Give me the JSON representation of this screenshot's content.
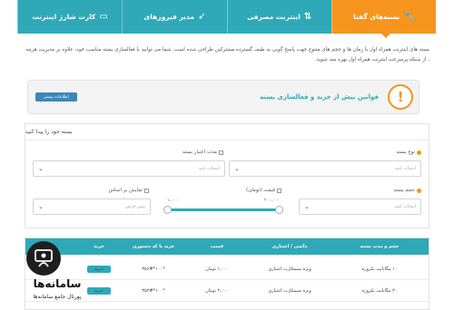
{
  "tabs": [
    {
      "label": "بسته‌های گفتا",
      "icon": "wrench-icon",
      "active": true
    },
    {
      "label": "اینترنت مصرفی",
      "icon": "updown-arrows-icon",
      "active": false
    },
    {
      "label": "مدیر فیروزهای",
      "icon": "rocket-icon",
      "active": false
    },
    {
      "label": "کارت شارژ اینترنت",
      "icon": "card-icon",
      "active": false
    }
  ],
  "intro_text": "بسته های اینترنت همراه اول با زمان ها و حجم های متنوع جهت پاسخ گویی به طیف گسترده مشترکین طراحی شده است. شما می توانید با فعالسازی بسته مناسب خود، علاوه بر مدیریت هزینه ، از شبکه پرسرعت اینترنت همراه اول بهره مند شوید.",
  "tip": {
    "title": "قوانین بیش از خرید و فعالسازی بسته",
    "button": "اطلاعات بیشتر",
    "icon": "exclamation-icon"
  },
  "finder": {
    "title": "بسته خود را پیدا کنید",
    "fields": {
      "package_type": {
        "label": "نوع بسته",
        "placeholder": "انتخاب کنید"
      },
      "validity": {
        "label": "مدت اعتبار بسته",
        "placeholder": "انتخاب کنید"
      },
      "volume": {
        "label": "حجم بسته",
        "placeholder": "انتخاب کنید"
      },
      "price": {
        "label": "قیمت (تومان)",
        "min": "۱,۰۰۰",
        "max": "۲۰۰,۰۰۰"
      },
      "sort": {
        "label": "نمایش بر اساس",
        "placeholder": "پیش فرض"
      }
    }
  },
  "table": {
    "headers": [
      "حجم و مدت بسته",
      "دائمی / اعتباری",
      "قیمت",
      "خرید با کد دستوری",
      "خرید"
    ],
    "rows": [
      {
        "name": "۱۰ مگابایت یکروزه",
        "type": "ویژه سیمکارت اعتباری",
        "price": "۱,۰۰۰ تومان",
        "code": "*۱۰۰*۳۵۶#",
        "buy": "خرید"
      },
      {
        "name": "۳۰ مگابایت یکروزه",
        "type": "ویژه سیمکارت اعتباری",
        "price": "۲,۰۰۰ تومان",
        "code": "*۱۰۰*۳۵۳#",
        "buy": "خرید"
      }
    ]
  },
  "watermark": {
    "name": "سامانه‌ها",
    "subtitle": "پورتال جامع سامانه‌ها"
  },
  "colors": {
    "accent": "#f7941d",
    "teal": "#2fa9b8",
    "button_blue": "#3a88b8"
  }
}
